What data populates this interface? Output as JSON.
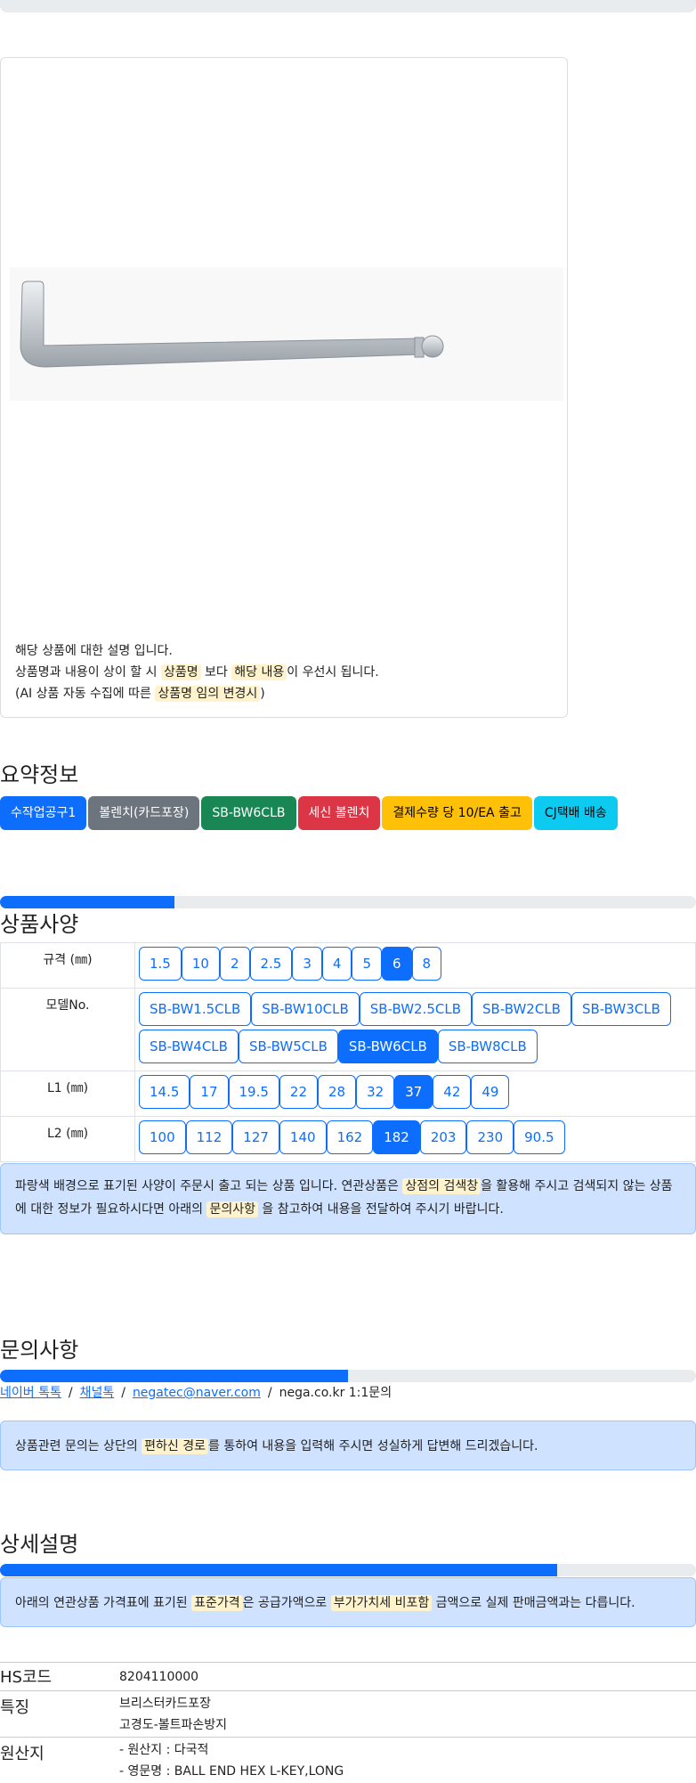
{
  "description": {
    "line1": "해당 상품에 대한 설명 입니다.",
    "line2_a": "상품명과 내용이 상이 할 시 ",
    "line2_hl1": "상품명",
    "line2_b": " 보다 ",
    "line2_hl2": "해당 내용",
    "line2_c": "이 우선시 됩니다.",
    "line3_a": "(AI 상품 자동 수집에 따른 ",
    "line3_hl": "상품명 임의 변경시",
    "line3_b": ")"
  },
  "summary": {
    "title": "요약정보",
    "badges": [
      {
        "label": "수작업공구1",
        "color": "#0d6efd"
      },
      {
        "label": "볼렌치(카드포장)",
        "color": "#6c757d"
      },
      {
        "label": "SB-BW6CLB",
        "color": "#198754"
      },
      {
        "label": "세신 볼렌치",
        "color": "#dc3545"
      },
      {
        "label": "결제수량 당 10/EA 출고",
        "color": "#ffc107"
      },
      {
        "label": "CJ택배 배송",
        "color": "#0dcaf0"
      }
    ]
  },
  "spec": {
    "title": "상품사양",
    "progress": 0.25,
    "rows": [
      {
        "label": "규격 (㎜)",
        "options": [
          "1.5",
          "10",
          "2",
          "2.5",
          "3",
          "4",
          "5",
          "6",
          "8"
        ],
        "selected": "6"
      },
      {
        "label": "모델No.",
        "options": [
          "SB-BW1.5CLB",
          "SB-BW10CLB",
          "SB-BW2.5CLB",
          "SB-BW2CLB",
          "SB-BW3CLB",
          "SB-BW4CLB",
          "SB-BW5CLB",
          "SB-BW6CLB",
          "SB-BW8CLB"
        ],
        "selected": "SB-BW6CLB"
      },
      {
        "label": "L1 (㎜)",
        "options": [
          "14.5",
          "17",
          "19.5",
          "22",
          "28",
          "32",
          "37",
          "42",
          "49"
        ],
        "selected": "37"
      },
      {
        "label": "L2 (㎜)",
        "options": [
          "100",
          "112",
          "127",
          "140",
          "162",
          "182",
          "203",
          "230",
          "90.5"
        ],
        "selected": "182"
      }
    ],
    "notice_a": "파랑색 배경으로 표기된 사양이 주문시 출고 되는 상품 입니다. 연관상품은 ",
    "notice_hl1": "상점의 검색창",
    "notice_b": "을 활용해 주시고 검색되지 않는 상품에 대한 정보가 필요하시다면 아래의 ",
    "notice_hl2": "문의사항",
    "notice_c": " 을 참고하여 내용을 전달하여 주시기 바랍니다."
  },
  "inquiry": {
    "title": "문의사항",
    "progress": 0.5,
    "links": [
      "네이버 톡톡",
      "채널톡",
      "negatec@naver.com"
    ],
    "plain": "nega.co.kr 1:1문의",
    "notice_a": "상품관련 문의는 상단의 ",
    "notice_hl": "편하신 경로",
    "notice_b": "를 통하여 내용을 입력해 주시면 성실하게 답변해 드리겠습니다."
  },
  "detail": {
    "title": "상세설명",
    "progress": 0.8,
    "notice_a": "아래의 연관상품 가격표에 표기된 ",
    "notice_hl1": "표준가격",
    "notice_b": "은 공급가액으로 ",
    "notice_hl2": "부가가치세 비포함",
    "notice_c": " 금액으로 실제 판매금액과는 다릅니다.",
    "hs_label": "HS코드",
    "hs_value": "8204110000",
    "feature_label": "특징",
    "feature_1": "브리스터카드포장",
    "feature_2": "고경도-볼트파손방지",
    "origin_label": "원산지",
    "origin_1": "- 원산지 : 다국적",
    "origin_2": "- 영문명 : BALL END HEX L-KEY,LONG"
  }
}
